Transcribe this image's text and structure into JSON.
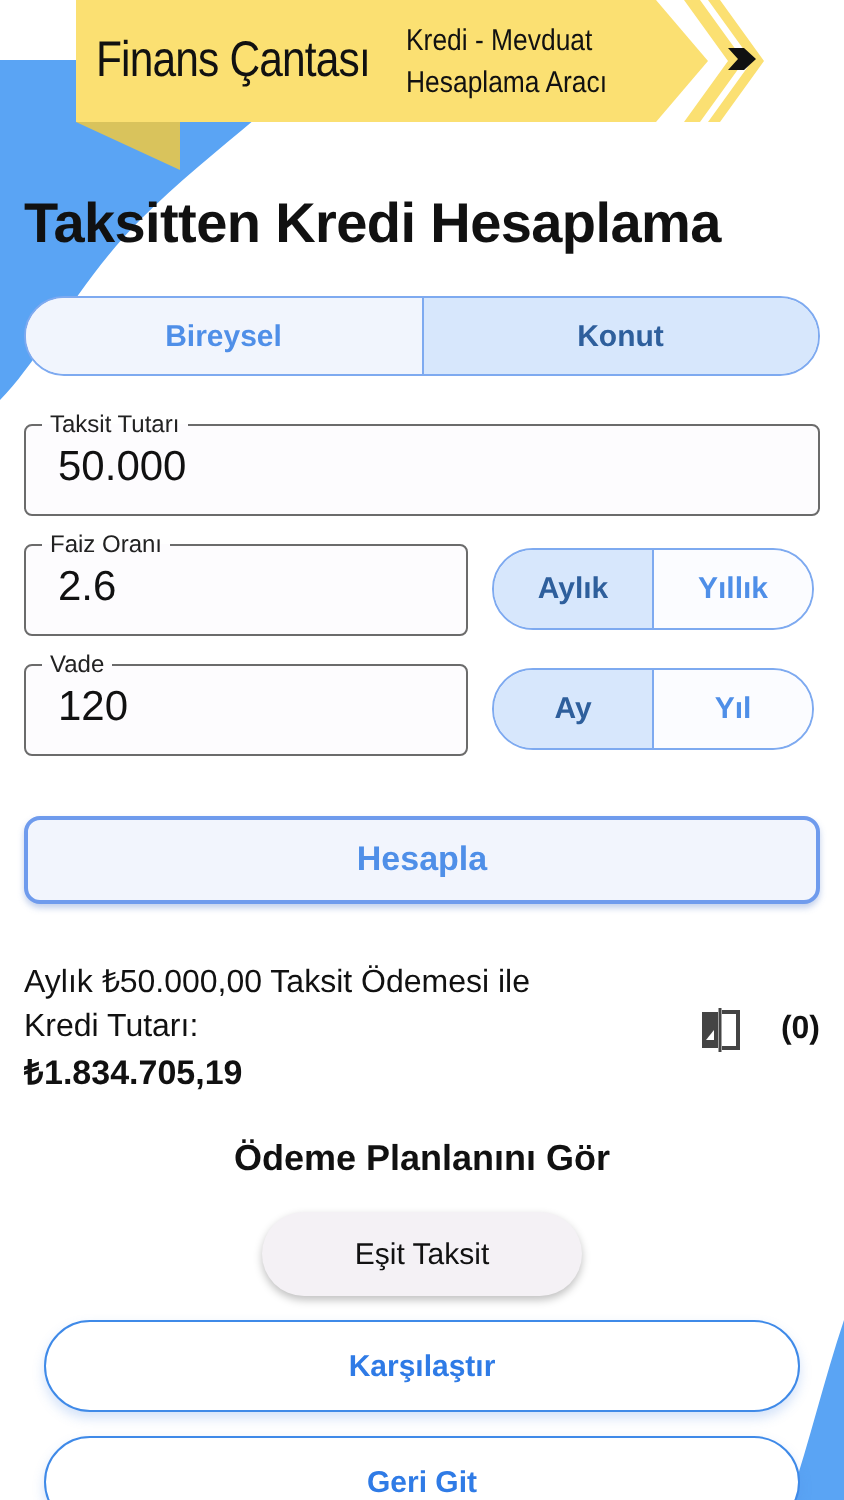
{
  "header": {
    "title": "Finans Çantası",
    "subtitle_lines": [
      "Kredi - Mevduat",
      "Hesaplama Aracı"
    ]
  },
  "page_title": "Taksitten Kredi Hesaplama",
  "loan_types": [
    {
      "label": "Bireysel",
      "selected": false
    },
    {
      "label": "Konut",
      "selected": true
    }
  ],
  "fields": [
    {
      "label": "Taksit Tutarı",
      "value": "50.000"
    },
    {
      "label": "Faiz Oranı",
      "value": "2.6",
      "units": [
        {
          "label": "Aylık",
          "selected": true
        },
        {
          "label": "Yıllık",
          "selected": false
        }
      ]
    },
    {
      "label": "Vade",
      "value": "120",
      "units": [
        {
          "label": "Ay",
          "selected": true
        },
        {
          "label": "Yıl",
          "selected": false
        }
      ]
    }
  ],
  "calculate_button": "Hesapla",
  "result": {
    "text": "Aylık ₺50.000,00 Taksit Ödemesi ile Kredi Tutarı:",
    "amount": "₺1.834.705,19",
    "compare_count": "(0)"
  },
  "plan_heading": "Ödeme Planlanını Gör",
  "plan_button": "Eşit Taksit",
  "buttons": [
    {
      "label": "Karşılaştır"
    },
    {
      "label": "Geri Git"
    }
  ]
}
